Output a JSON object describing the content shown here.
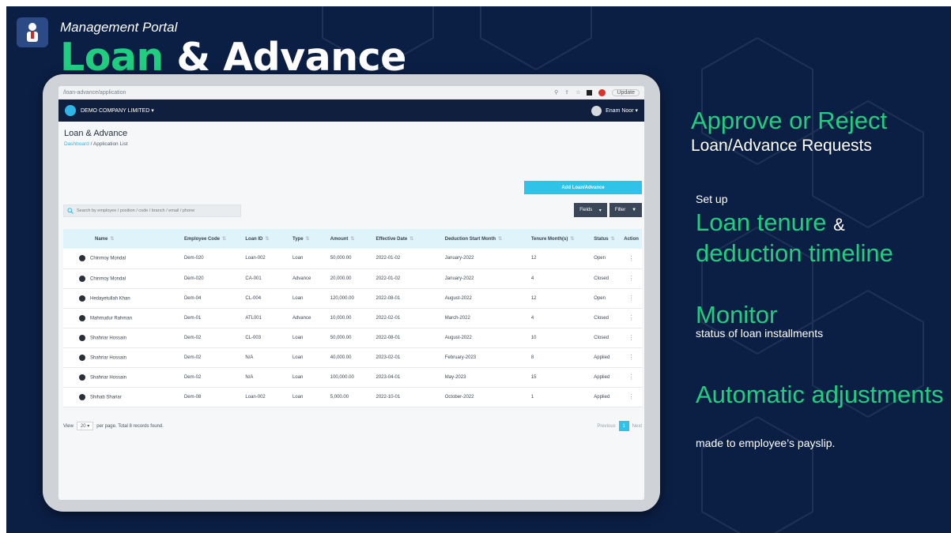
{
  "header": {
    "kicker": "Management Portal",
    "title_green": "Loan",
    "title_white": "& Advance"
  },
  "browser": {
    "url": "/loan-advance/application",
    "update_label": "Update"
  },
  "app": {
    "company": "DEMO COMPANY LIMITED ▾",
    "user": "Enam Noor ▾",
    "page_title": "Loan & Advance",
    "breadcrumb_link": "Dashboard",
    "breadcrumb_current": " / Application List",
    "add_button": "Add Loan/Advance",
    "search_placeholder": "Search by employee / position / code / branch / email / phone",
    "fields_button": "Fields",
    "filter_button": "Filter",
    "columns": [
      "Name",
      "Employee Code",
      "Loan ID",
      "Type",
      "Amount",
      "Effective Date",
      "Deduction Start Month",
      "Tenure Month(s)",
      "Status",
      "Action"
    ],
    "rows": [
      [
        "Chinmoy Mondal",
        "Dem-020",
        "Loan-002",
        "Loan",
        "50,000.00",
        "2022-01-02",
        "January-2022",
        "12",
        "Open"
      ],
      [
        "Chinmoy Mondal",
        "Dem-020",
        "CA-001",
        "Advance",
        "20,000.00",
        "2022-01-02",
        "January-2022",
        "4",
        "Closed"
      ],
      [
        "Hedayetullah Khan",
        "Dem-04",
        "CL-004",
        "Loan",
        "120,000.00",
        "2022-08-01",
        "August-2022",
        "12",
        "Open"
      ],
      [
        "Mahmudur Rahman",
        "Dem-01",
        "ATL001",
        "Advance",
        "10,000.00",
        "2022-02-01",
        "March-2022",
        "4",
        "Closed"
      ],
      [
        "Shahriar Hossain",
        "Dem-02",
        "CL-003",
        "Loan",
        "50,000.00",
        "2022-08-01",
        "August-2022",
        "10",
        "Closed"
      ],
      [
        "Shahriar Hossain",
        "Dem-02",
        "N/A",
        "Loan",
        "40,000.00",
        "2023-02-01",
        "February-2023",
        "8",
        "Applied"
      ],
      [
        "Shahriar Hossain",
        "Dem-02",
        "N/A",
        "Loan",
        "100,000.00",
        "2023-04-01",
        "May-2023",
        "15",
        "Applied"
      ],
      [
        "Shihab Shariar",
        "Dem-08",
        "Loan-002",
        "Loan",
        "5,000.00",
        "2022-10-01",
        "October-2022",
        "1",
        "Applied"
      ]
    ],
    "footer_view": "View",
    "page_size": "20",
    "footer_text": "per page. Total 8 records found.",
    "pager_prev": "Previous",
    "pager_current": "1",
    "pager_next": "Next"
  },
  "features": {
    "f1_head": "Approve or Reject",
    "f1_sub": "Loan/Advance Requests",
    "f2_small": "Set up",
    "f2_head_a": "Loan tenure",
    "f2_amp": "&",
    "f2_head_b": "deduction timeline",
    "f3_head": "Monitor",
    "f3_sub": "status of loan installments",
    "f4_head": "Automatic adjustments",
    "f4_sub": "made to employee’s payslip."
  },
  "colors": {
    "background": "#0b1f45",
    "accent_green": "#1fcf7f",
    "accent_cyan": "#2fc3ea"
  }
}
